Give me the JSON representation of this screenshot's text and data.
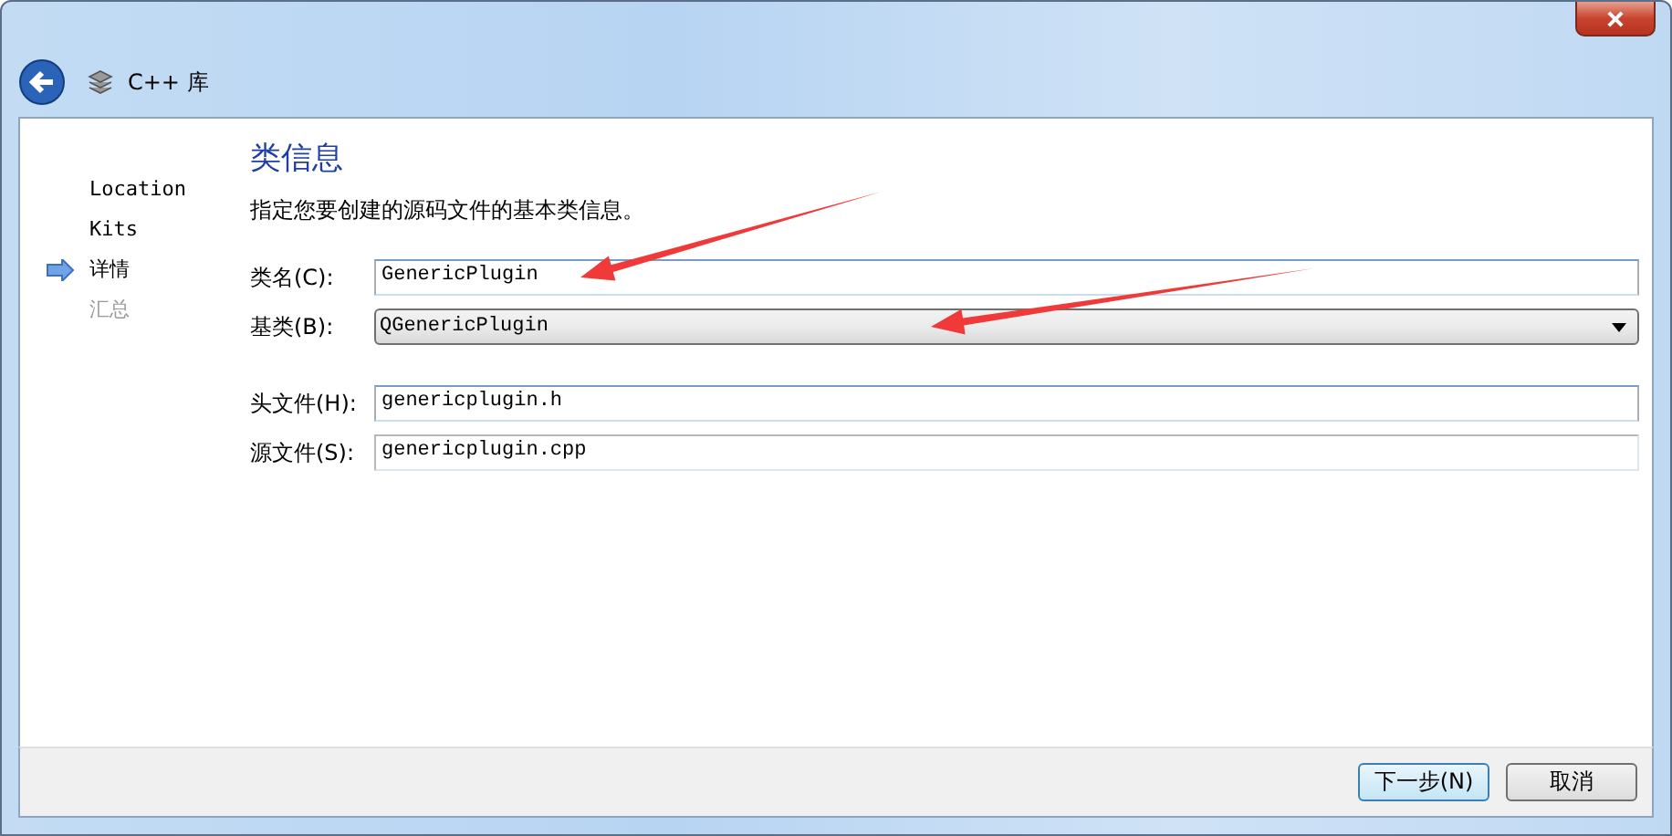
{
  "window": {
    "title": "C++ 库"
  },
  "steps": [
    {
      "label": "Location",
      "selected": false,
      "disabled": false
    },
    {
      "label": "Kits",
      "selected": false,
      "disabled": false
    },
    {
      "label": "详情",
      "selected": true,
      "disabled": false
    },
    {
      "label": "汇总",
      "selected": false,
      "disabled": true
    }
  ],
  "page": {
    "heading": "类信息",
    "description": "指定您要创建的源码文件的基本类信息。"
  },
  "fields": [
    {
      "kind": "text",
      "label": "类名(C):",
      "value": "GenericPlugin",
      "annotated": true
    },
    {
      "kind": "combo",
      "label": "基类(B):",
      "value": "QGenericPlugin",
      "annotated": true
    },
    {
      "kind": "text",
      "label": "头文件(H):",
      "value": "genericplugin.h",
      "annotated": false
    },
    {
      "kind": "text",
      "label": "源文件(S):",
      "value": "genericplugin.cpp",
      "annotated": false
    }
  ],
  "buttons": [
    {
      "label": "下一步(N)",
      "default": true
    },
    {
      "label": "取消",
      "default": false
    }
  ]
}
